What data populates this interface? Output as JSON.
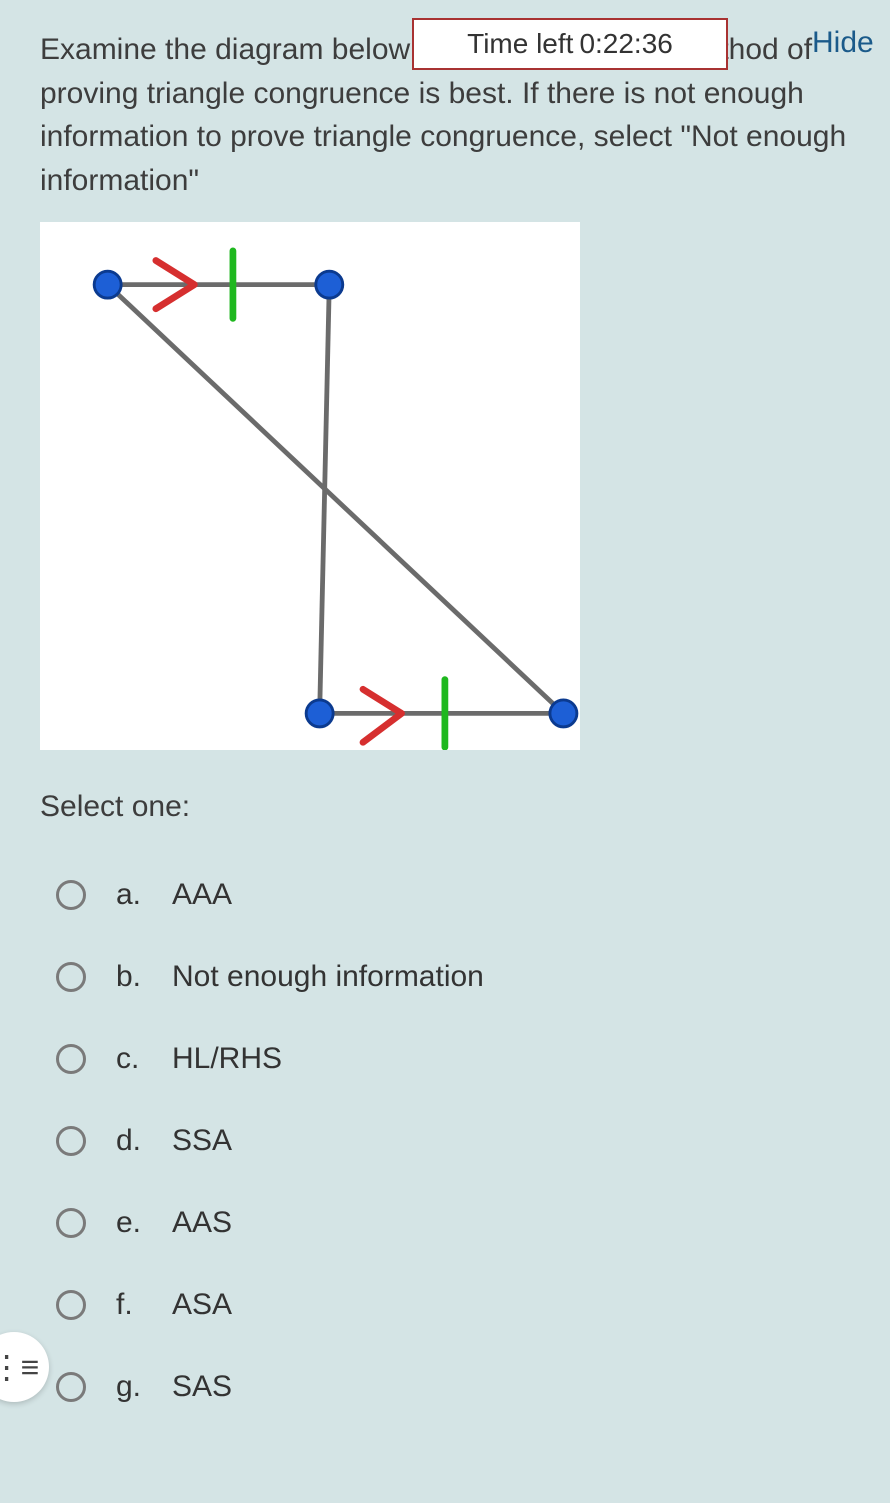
{
  "timer": {
    "prefix": "Time left",
    "value": "0:22:36",
    "hide_label": "Hide"
  },
  "question": {
    "text": "Examine the diagram below to determine which method of proving triangle congruence is best.  If there is not enough information to prove triangle congruence, select \"Not enough information\""
  },
  "prompt": "Select one:",
  "options": [
    {
      "letter": "a.",
      "text": "AAA"
    },
    {
      "letter": "b.",
      "text": "Not enough information"
    },
    {
      "letter": "c.",
      "text": "HL/RHS"
    },
    {
      "letter": "d.",
      "text": "SSA"
    },
    {
      "letter": "e.",
      "text": "AAS"
    },
    {
      "letter": "f.",
      "text": "ASA"
    },
    {
      "letter": "g.",
      "text": "SAS"
    }
  ],
  "chart_data": {
    "type": "diagram",
    "description": "Two triangles sharing a common side. Top horizontal segment marked with an arrow (parallel mark) and a tick (congruent mark). Bottom horizontal segment marked with the same arrow and tick. A diagonal runs from top-right vertex to bottom-left vertex, shared between triangles.",
    "points": {
      "A": [
        70,
        65
      ],
      "B": [
        300,
        65
      ],
      "C": [
        290,
        510
      ],
      "D": [
        543,
        510
      ]
    },
    "segments": [
      {
        "from": "A",
        "to": "B",
        "marks": [
          "arrow",
          "tick"
        ]
      },
      {
        "from": "B",
        "to": "C",
        "marks": []
      },
      {
        "from": "A",
        "to": "D",
        "marks": []
      },
      {
        "from": "C",
        "to": "D",
        "marks": [
          "arrow",
          "tick"
        ]
      }
    ],
    "title": "",
    "xlabel": "",
    "ylabel": ""
  },
  "menu_icon": "list-icon"
}
